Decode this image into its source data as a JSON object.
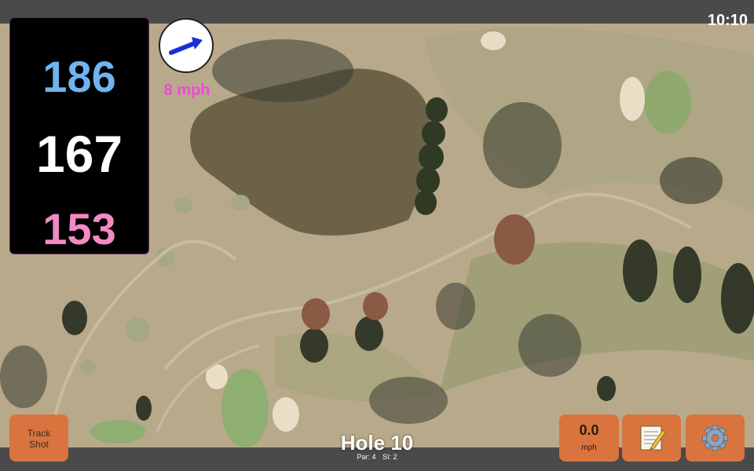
{
  "status": {
    "time": "10:10"
  },
  "distances": {
    "back": "186",
    "middle": "167",
    "front": "153"
  },
  "wind": {
    "speed": "8 mph",
    "icon": "wind-arrow-icon"
  },
  "hole": {
    "title": "Hole 10",
    "par": "Par: 4",
    "si": "SI: 2"
  },
  "buttons": {
    "track_shot_line1": "Track",
    "track_shot_line2": "Shot",
    "speed_value": "0.0",
    "speed_unit": "mph",
    "notes_icon": "notepad-icon",
    "settings_icon": "gear-icon"
  },
  "colors": {
    "back_distance": "#6fb4f0",
    "middle_distance": "#ffffff",
    "front_distance": "#f28ac4",
    "wind_text": "#f04ad8",
    "button_bg": "#d9743e",
    "bar_bg": "#4a4a4a"
  }
}
